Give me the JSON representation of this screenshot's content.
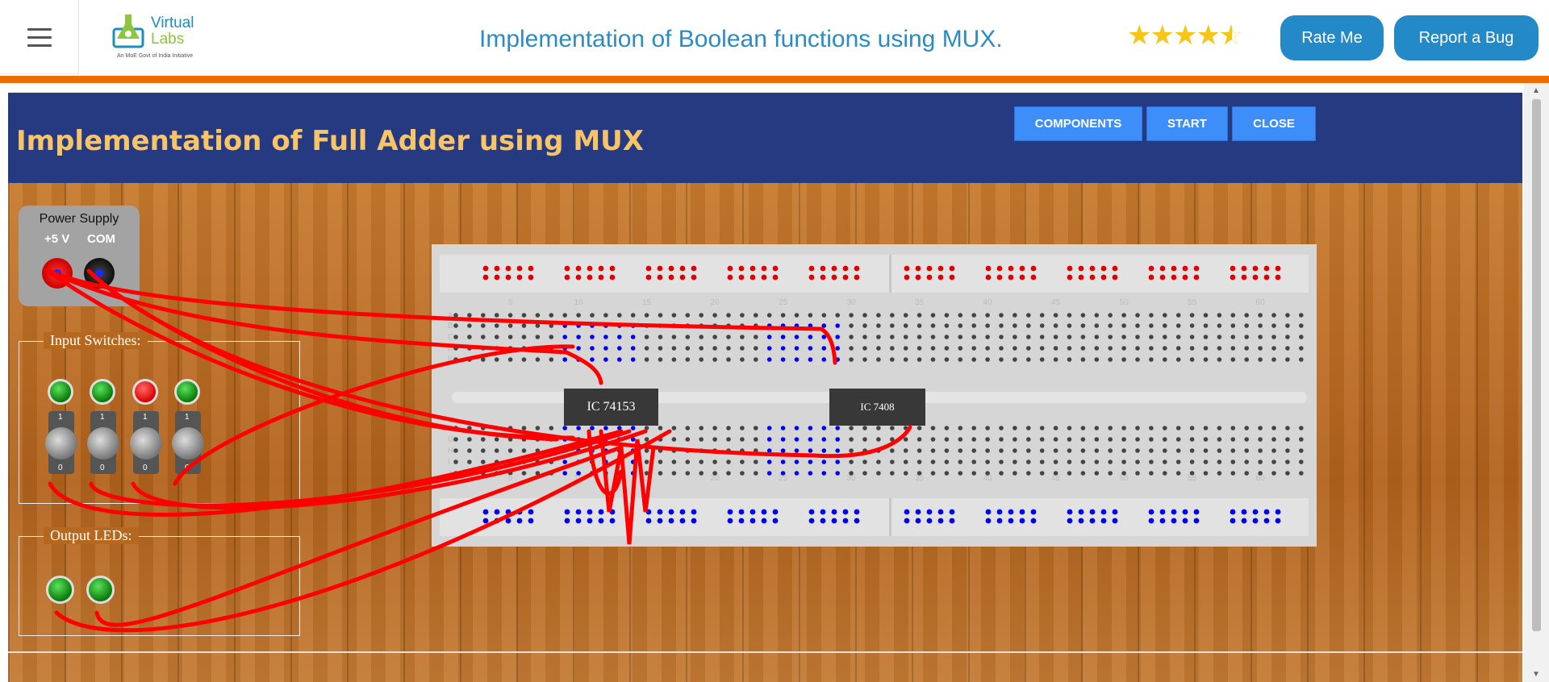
{
  "header": {
    "menu_icon": "hamburger-icon",
    "logo": {
      "line1": "Virtual",
      "line2": "Labs",
      "tagline": "An MoE Govt of India Initiative"
    },
    "title": "Implementation of Boolean functions using MUX.",
    "rating": 4.5,
    "rate_label": "Rate Me",
    "bug_label": "Report a Bug"
  },
  "colors": {
    "orange": "#ef6c00",
    "band": "#263a82",
    "title": "#f7c468",
    "button": "#3d8ef8",
    "wire": "#ff0000"
  },
  "simulator": {
    "title": "Implementation of Full Adder using MUX",
    "buttons": [
      "COMPONENTS",
      "START",
      "CLOSE"
    ],
    "power_supply": {
      "title": "Power Supply",
      "plus": "+5 V",
      "com": "COM"
    },
    "input_switches": {
      "label": "Input Switches:",
      "leds": [
        "green",
        "green",
        "red",
        "green"
      ],
      "switch_top": "1",
      "switch_bottom": "0"
    },
    "output_leds": {
      "label": "Output LEDs:",
      "leds": [
        "green",
        "green"
      ]
    },
    "breadboard": {
      "ics": [
        "IC 74153",
        "IC 7408"
      ],
      "col_numbers": [
        "5",
        "10",
        "15",
        "20",
        "25",
        "30",
        "35",
        "40",
        "45",
        "50",
        "55",
        "60"
      ],
      "row_letters_top": [
        "A",
        "B",
        "C",
        "D",
        "E"
      ],
      "row_letters_bottom": [
        "F",
        "G",
        "H",
        "I",
        "J"
      ]
    }
  }
}
